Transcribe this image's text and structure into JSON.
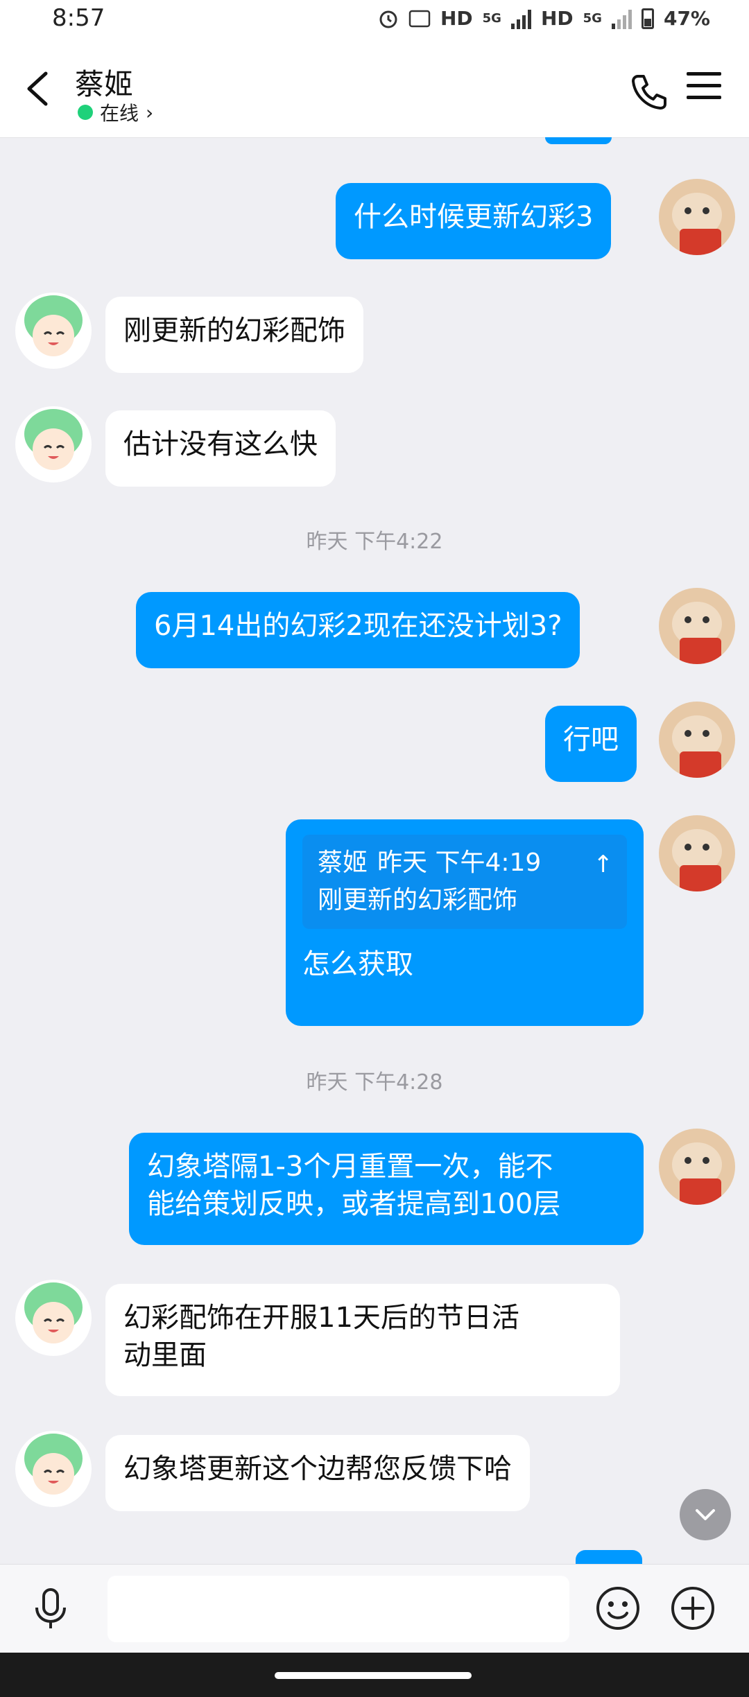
{
  "status_bar": {
    "time": "8:57",
    "network1": "HD",
    "net_type1": "5G",
    "network2": "HD",
    "net_type2": "5G",
    "battery": "47%"
  },
  "header": {
    "contact_name": "蔡姬",
    "presence": "在线",
    "presence_chevron": "›"
  },
  "messages": [
    {
      "id": "m1",
      "sender": "me",
      "text": "什么时候更新幻彩3"
    },
    {
      "id": "m2",
      "sender": "them",
      "text": "刚更新的幻彩配饰"
    },
    {
      "id": "m3",
      "sender": "them",
      "text": "估计没有这么快"
    },
    {
      "id": "t1",
      "type": "timestamp",
      "text": "昨天 下午4:22"
    },
    {
      "id": "m4",
      "sender": "me",
      "text": "6月14出的幻彩2现在还没计划3?"
    },
    {
      "id": "m5",
      "sender": "me",
      "text": "行吧"
    },
    {
      "id": "m6",
      "sender": "me",
      "quote": {
        "author": "蔡姬",
        "time": "昨天 下午4:19",
        "text": "刚更新的幻彩配饰",
        "arrow": "↑"
      },
      "text": "怎么获取"
    },
    {
      "id": "t2",
      "type": "timestamp",
      "text": "昨天 下午4:28"
    },
    {
      "id": "m7",
      "sender": "me",
      "line1": "幻象塔隔1-3个月重置一次，能不",
      "line2": "能给策划反映，或者提高到100层"
    },
    {
      "id": "m8",
      "sender": "them",
      "line1": "幻彩配饰在开服11天后的节日活",
      "line2": "动里面"
    },
    {
      "id": "m9",
      "sender": "them",
      "text": "幻象塔更新这个边帮您反馈下哈"
    }
  ],
  "input_bar": {
    "placeholder": ""
  },
  "colors": {
    "my_bubble": "#0099ff",
    "their_bubble": "#ffffff",
    "background": "#efeff3",
    "online": "#1fd17a"
  },
  "icons": [
    "back-icon",
    "phone-icon",
    "menu-icon",
    "mic-icon",
    "emoji-icon",
    "plus-icon",
    "chevron-down-icon",
    "cat-avatar",
    "anime-avatar"
  ]
}
